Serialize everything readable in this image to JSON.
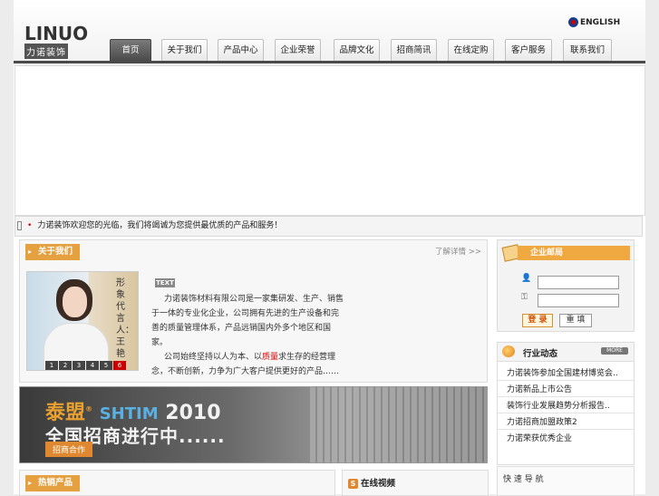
{
  "header": {
    "logo_big": "LINUO",
    "logo_small": "力诺装饰",
    "lang": "ENGLISH"
  },
  "nav": {
    "tabs": [
      {
        "label": "首页",
        "active": true
      },
      {
        "label": "关于我们"
      },
      {
        "label": "产品中心"
      },
      {
        "label": "企业荣誉"
      },
      {
        "label": "品牌文化"
      },
      {
        "label": "招商简讯"
      },
      {
        "label": "在线定购"
      },
      {
        "label": "客户服务"
      },
      {
        "label": "联系我们"
      }
    ]
  },
  "notice": {
    "text": "力诺装饰欢迎您的光临，我们将竭诚为您提供最优质的产品和服务！"
  },
  "about": {
    "title": "关于我们",
    "more": "了解详情 >>",
    "tag": "TEXT",
    "spokesperson": "形象代言人：王艳",
    "nums": [
      "1",
      "2",
      "3",
      "4",
      "5",
      "6"
    ],
    "p1": "力诺装饰材料有限公司是一家集研发、生产、销售于一体的专业化企业，公司拥有先进的生产设备和完善的质量管理体系，产品远销国内外多个地区和国家。",
    "p2_a": "公司始终坚持以人为本、以",
    "p2_hl": "质量",
    "p2_b": "求生存的经营理念，不断创新，力争为广大客户提供更好的产品……"
  },
  "ad": {
    "line1": "泰盟",
    "line1_en": "SHTIM",
    "line1_year": "2010",
    "line2": "全国招商进行中......",
    "button": "招商合作"
  },
  "mail": {
    "title": "企业邮局",
    "user_placeholder": "",
    "pass_placeholder": "",
    "login": "登 录",
    "reset": "重 填"
  },
  "news": {
    "title": "行业动态",
    "more": "MORE",
    "items": [
      "力诺装饰参加全国建材博览会..",
      "力诺新品上市公告",
      "装饰行业发展趋势分析报告..",
      "力诺招商加盟政策2",
      "力诺荣获优秀企业"
    ]
  },
  "bottom": {
    "hot_title": "热销产品",
    "video_title": "在线视频",
    "video_icon": "S",
    "quick": "快 速 导 航"
  }
}
